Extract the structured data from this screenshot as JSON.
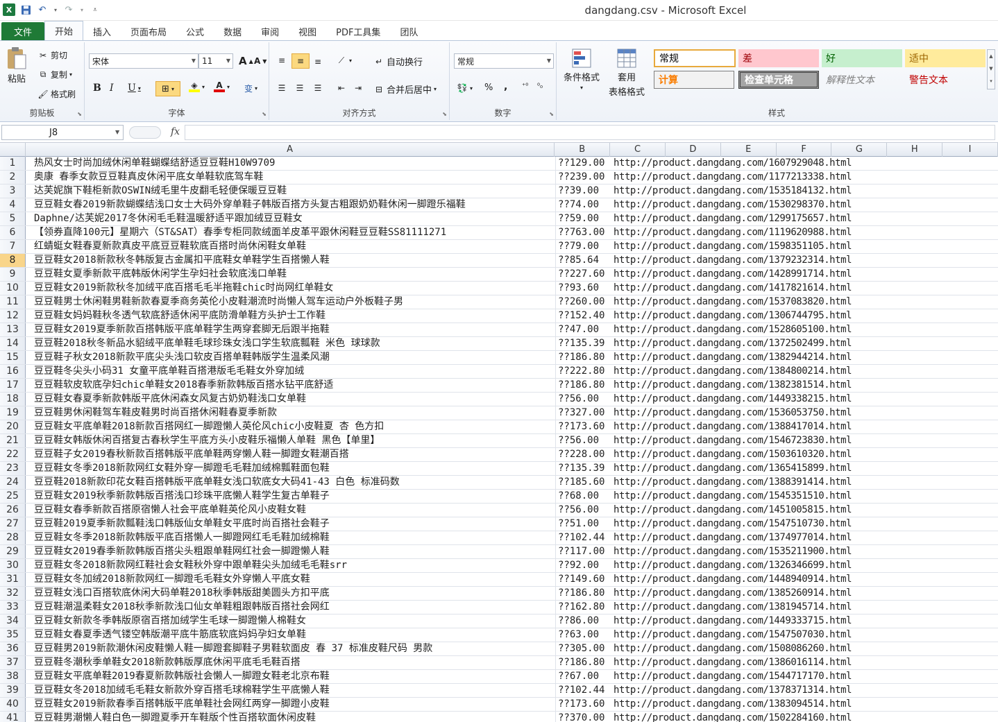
{
  "window": {
    "title": "dangdang.csv  -  Microsoft Excel",
    "app_icon": "X"
  },
  "qat": {
    "save_icon": "save-icon",
    "undo_icon": "undo-icon",
    "redo_icon": "redo-icon"
  },
  "tabs": [
    "文件",
    "开始",
    "插入",
    "页面布局",
    "公式",
    "数据",
    "审阅",
    "视图",
    "PDF工具集",
    "团队"
  ],
  "ribbon": {
    "clipboard": {
      "paste": "粘贴",
      "cut": "剪切",
      "copy": "复制",
      "format_painter": "格式刷",
      "label": "剪贴板"
    },
    "font": {
      "name": "宋体",
      "size": "11",
      "label": "字体",
      "bold": "B",
      "italic": "I",
      "underline": "U",
      "grow": "A",
      "shrink": "A",
      "font_color_letter": "A",
      "phonetic": "变"
    },
    "alignment": {
      "wrap": "自动换行",
      "merge": "合并后居中",
      "label": "对齐方式"
    },
    "number": {
      "format": "常规",
      "percent": "%",
      "comma": ",",
      "label": "数字"
    },
    "styles": {
      "conditional": "条件格式",
      "table_1": "套用",
      "table_2": "表格格式",
      "cells": [
        "常规",
        "差",
        "好",
        "适中",
        "计算",
        "检查单元格",
        "解释性文本",
        "警告文本"
      ],
      "label": "样式"
    }
  },
  "formula_bar": {
    "name_box": "J8",
    "fx": "fx",
    "value": ""
  },
  "columns": [
    "A",
    "B",
    "C",
    "D",
    "E",
    "F",
    "G",
    "H",
    "I"
  ],
  "selected_row": 8,
  "rows": [
    {
      "n": 1,
      "a": "热风女士时尚加绒休闲单鞋蝴蝶结舒适豆豆鞋H10W9709",
      "b": "??129.00",
      "c": "http://product.dangdang.com/1607929048.html"
    },
    {
      "n": 2,
      "a": "奥康 春季女款豆豆鞋真皮休闲平底女单鞋软底驾车鞋",
      "b": "??239.00",
      "c": "http://product.dangdang.com/1177213338.html"
    },
    {
      "n": 3,
      "a": "达芙妮旗下鞋柜新款OSWIN绒毛里牛皮翻毛轻便保暖豆豆鞋",
      "b": "??39.00",
      "c": "http://product.dangdang.com/1535184132.html"
    },
    {
      "n": 4,
      "a": "豆豆鞋女春2019新款蝴蝶结浅口女士大码外穿单鞋子韩版百搭方头复古粗跟奶奶鞋休闲一脚蹬乐福鞋",
      "b": "??74.00",
      "c": "http://product.dangdang.com/1530298370.html"
    },
    {
      "n": 5,
      "a": "Daphne/达芙妮2017冬休闲毛毛鞋温暖舒适平跟加绒豆豆鞋女",
      "b": "??59.00",
      "c": "http://product.dangdang.com/1299175657.html"
    },
    {
      "n": 6,
      "a": "【领券直降100元】星期六（ST&SAT）春季专柜同款绒面羊皮革平跟休闲鞋豆豆鞋SS81111271",
      "b": "??763.00",
      "c": "http://product.dangdang.com/1119620988.html"
    },
    {
      "n": 7,
      "a": "红蜻蜓女鞋春夏新款真皮平底豆豆鞋软底百搭时尚休闲鞋女单鞋",
      "b": "??79.00",
      "c": "http://product.dangdang.com/1598351105.html"
    },
    {
      "n": 8,
      "a": "豆豆鞋女2018新款秋冬韩版复古金属扣平底鞋女单鞋学生百搭懒人鞋",
      "b": "??85.64",
      "c": "http://product.dangdang.com/1379232314.html"
    },
    {
      "n": 9,
      "a": "豆豆鞋女夏季新款平底韩版休闲学生孕妇社会软底浅口单鞋",
      "b": "??227.60",
      "c": "http://product.dangdang.com/1428991714.html"
    },
    {
      "n": 10,
      "a": "豆豆鞋女2019新款秋冬加绒平底百搭毛毛半拖鞋chic时尚网红单鞋女",
      "b": "??93.60",
      "c": "http://product.dangdang.com/1417821614.html"
    },
    {
      "n": 11,
      "a": "豆豆鞋男士休闲鞋男鞋新款春夏季商务英伦小皮鞋潮流时尚懒人驾车运动户外板鞋子男",
      "b": "??260.00",
      "c": "http://product.dangdang.com/1537083820.html"
    },
    {
      "n": 12,
      "a": "豆豆鞋女妈妈鞋秋冬透气软底舒适休闲平底防滑单鞋方头护士工作鞋",
      "b": "??152.40",
      "c": "http://product.dangdang.com/1306744795.html"
    },
    {
      "n": 13,
      "a": "豆豆鞋女2019夏季新款百搭韩版平底单鞋学生两穿套脚无后跟半拖鞋",
      "b": "??47.00",
      "c": "http://product.dangdang.com/1528605100.html"
    },
    {
      "n": 14,
      "a": "豆豆鞋2018秋冬新品水貂绒平底单鞋毛球珍珠女浅口学生软底瓢鞋 米色 球球款",
      "b": "??135.39",
      "c": "http://product.dangdang.com/1372502499.html"
    },
    {
      "n": 15,
      "a": "豆豆鞋子秋女2018新款平底尖头浅口软皮百搭单鞋韩版学生温柔风潮",
      "b": "??186.80",
      "c": "http://product.dangdang.com/1382944214.html"
    },
    {
      "n": 16,
      "a": "豆豆鞋冬尖头小码31 女童平底单鞋百搭港版毛毛鞋女外穿加绒",
      "b": "??222.80",
      "c": "http://product.dangdang.com/1384800214.html"
    },
    {
      "n": 17,
      "a": "豆豆鞋软皮软底孕妇chic单鞋女2018春季新款韩版百搭水钻平底舒适",
      "b": "??186.80",
      "c": "http://product.dangdang.com/1382381514.html"
    },
    {
      "n": 18,
      "a": "豆豆鞋女春夏季新款韩版平底休闲森女风复古奶奶鞋浅口女单鞋",
      "b": "??56.00",
      "c": "http://product.dangdang.com/1449338215.html"
    },
    {
      "n": 19,
      "a": "豆豆鞋男休闲鞋驾车鞋皮鞋男时尚百搭休闲鞋春夏季新款",
      "b": "??327.00",
      "c": "http://product.dangdang.com/1536053750.html"
    },
    {
      "n": 20,
      "a": "豆豆鞋女平底单鞋2018新款百搭网红一脚蹬懒人英伦风chic小皮鞋夏 杏 色方扣",
      "b": "??173.60",
      "c": "http://product.dangdang.com/1388417014.html"
    },
    {
      "n": 21,
      "a": "豆豆鞋女韩版休闲百搭复古春秋学生平底方头小皮鞋乐福懒人单鞋 黑色【单里】",
      "b": "??56.00",
      "c": "http://product.dangdang.com/1546723830.html"
    },
    {
      "n": 22,
      "a": "豆豆鞋子女2019春秋新款百搭韩版平底单鞋两穿懒人鞋一脚蹬女鞋潮百搭",
      "b": "??228.00",
      "c": "http://product.dangdang.com/1503610320.html"
    },
    {
      "n": 23,
      "a": "豆豆鞋女冬季2018新款网红女鞋外穿一脚蹬毛毛鞋加绒棉瓢鞋面包鞋",
      "b": "??135.39",
      "c": "http://product.dangdang.com/1365415899.html"
    },
    {
      "n": 24,
      "a": "豆豆鞋2018新款印花女鞋百搭韩版平底单鞋女浅口软底女大码41-43 白色 标准码数",
      "b": "??185.60",
      "c": "http://product.dangdang.com/1388391414.html"
    },
    {
      "n": 25,
      "a": "豆豆鞋女2019秋季新款韩版百搭浅口珍珠平底懒人鞋学生复古单鞋子",
      "b": "??68.00",
      "c": "http://product.dangdang.com/1545351510.html"
    },
    {
      "n": 26,
      "a": "豆豆鞋女春季新款百搭原宿懒人社会平底单鞋英伦风小皮鞋女鞋",
      "b": "??56.00",
      "c": "http://product.dangdang.com/1451005815.html"
    },
    {
      "n": 27,
      "a": "豆豆鞋2019夏季新款瓢鞋浅口韩版仙女单鞋女平底时尚百搭社会鞋子",
      "b": "??51.00",
      "c": "http://product.dangdang.com/1547510730.html"
    },
    {
      "n": 28,
      "a": "豆豆鞋女冬季2018新款韩版平底百搭懒人一脚蹬网红毛毛鞋加绒棉鞋",
      "b": "??102.44",
      "c": "http://product.dangdang.com/1374977014.html"
    },
    {
      "n": 29,
      "a": "豆豆鞋女2019春季新款韩版百搭尖头粗跟单鞋网红社会一脚蹬懒人鞋",
      "b": "??117.00",
      "c": "http://product.dangdang.com/1535211900.html"
    },
    {
      "n": 30,
      "a": "豆豆鞋女冬2018新款网红鞋社会女鞋秋外穿中跟单鞋尖头加绒毛毛鞋srr",
      "b": "??92.00",
      "c": "http://product.dangdang.com/1326346699.html"
    },
    {
      "n": 31,
      "a": "豆豆鞋女冬加绒2018新款网红一脚蹬毛毛鞋女外穿懒人平底女鞋",
      "b": "??149.60",
      "c": "http://product.dangdang.com/1448940914.html"
    },
    {
      "n": 32,
      "a": "豆豆鞋女浅口百搭软底休闲大码单鞋2018秋季韩版甜美圆头方扣平底",
      "b": "??186.80",
      "c": "http://product.dangdang.com/1385260914.html"
    },
    {
      "n": 33,
      "a": "豆豆鞋潮温柔鞋女2018秋季新款浅口仙女单鞋粗跟韩版百搭社会网红",
      "b": "??162.80",
      "c": "http://product.dangdang.com/1381945714.html"
    },
    {
      "n": 34,
      "a": "豆豆鞋女新款冬季韩版原宿百搭加绒学生毛球一脚蹬懒人棉鞋女",
      "b": "??86.00",
      "c": "http://product.dangdang.com/1449333715.html"
    },
    {
      "n": 35,
      "a": "豆豆鞋女春夏季透气镂空韩版潮平底牛筋底软底妈妈孕妇女单鞋",
      "b": "??63.00",
      "c": "http://product.dangdang.com/1547507030.html"
    },
    {
      "n": 36,
      "a": "豆豆鞋男2019新款潮休闲皮鞋懒人鞋一脚蹬套脚鞋子男鞋软面皮 春 37 标准皮鞋尺码 男款",
      "b": "??305.00",
      "c": "http://product.dangdang.com/1508086260.html"
    },
    {
      "n": 37,
      "a": "豆豆鞋冬潮秋季单鞋女2018新款韩版厚底休闲平底毛毛鞋百搭",
      "b": "??186.80",
      "c": "http://product.dangdang.com/1386016114.html"
    },
    {
      "n": 38,
      "a": "豆豆鞋女平底单鞋2019春夏新款韩版社会懒人一脚蹬女鞋老北京布鞋",
      "b": "??67.00",
      "c": "http://product.dangdang.com/1544717170.html"
    },
    {
      "n": 39,
      "a": "豆豆鞋女冬2018加绒毛毛鞋女新款外穿百搭毛球棉鞋学生平底懒人鞋",
      "b": "??102.44",
      "c": "http://product.dangdang.com/1378371314.html"
    },
    {
      "n": 40,
      "a": "豆豆鞋女2019新款春季百搭韩版平底单鞋社会网红两穿一脚蹬小皮鞋",
      "b": "??173.60",
      "c": "http://product.dangdang.com/1383094514.html"
    },
    {
      "n": 41,
      "a": "豆豆鞋男潮懒人鞋白色一脚蹬夏季开车鞋版个性百搭软面休闲皮鞋",
      "b": "??370.00",
      "c": "http://product.dangdang.com/1502284160.html"
    }
  ]
}
